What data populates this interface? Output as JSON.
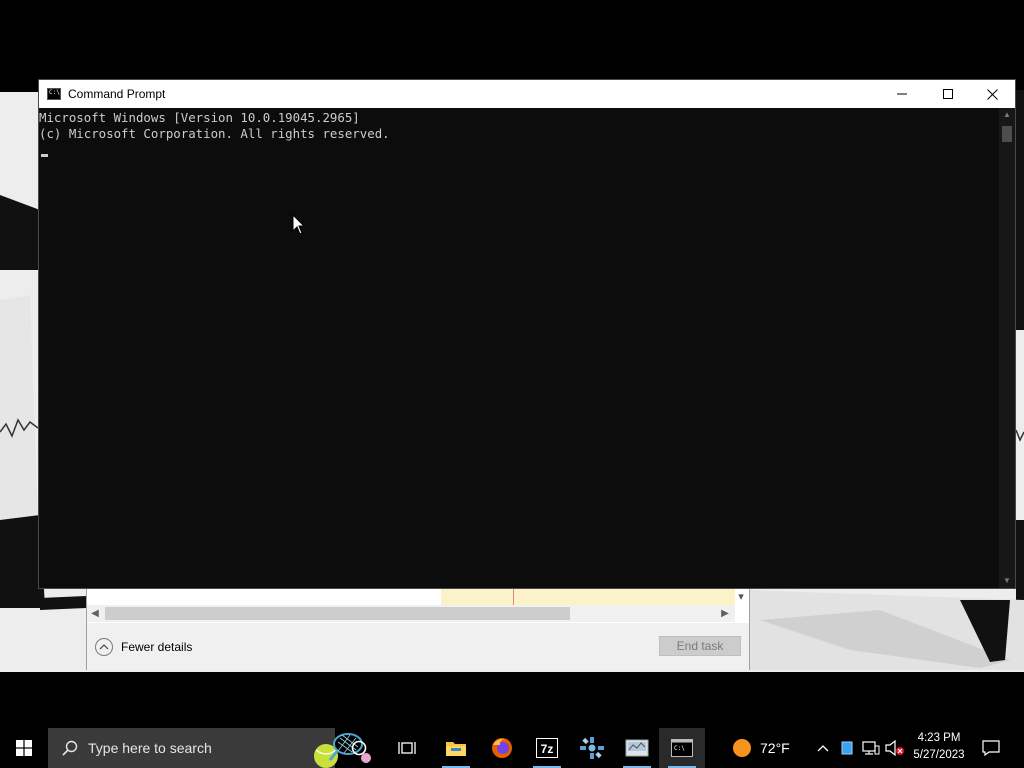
{
  "cmd": {
    "title": "Command Prompt",
    "icon_text": "C:\\",
    "lines": [
      "Microsoft Windows [Version 10.0.19045.2965]",
      "(c) Microsoft Corporation. All rights reserved."
    ]
  },
  "task_manager": {
    "fewer_details_label": "Fewer details",
    "end_task_label": "End task"
  },
  "taskbar": {
    "search_placeholder": "Type here to search",
    "apps": [
      "task-view",
      "file-explorer",
      "firefox",
      "7-zip",
      "ppsspp",
      "disk-image-app",
      "command-prompt"
    ],
    "active_app": "command-prompt"
  },
  "tray": {
    "weather_temp": "72°F",
    "time": "4:23 PM",
    "date": "5/27/2023"
  },
  "colors": {
    "console_bg": "#0c0c0c",
    "console_text": "#cccccc",
    "taskbar_bg": "#000000",
    "accent": "#76b9ed"
  }
}
